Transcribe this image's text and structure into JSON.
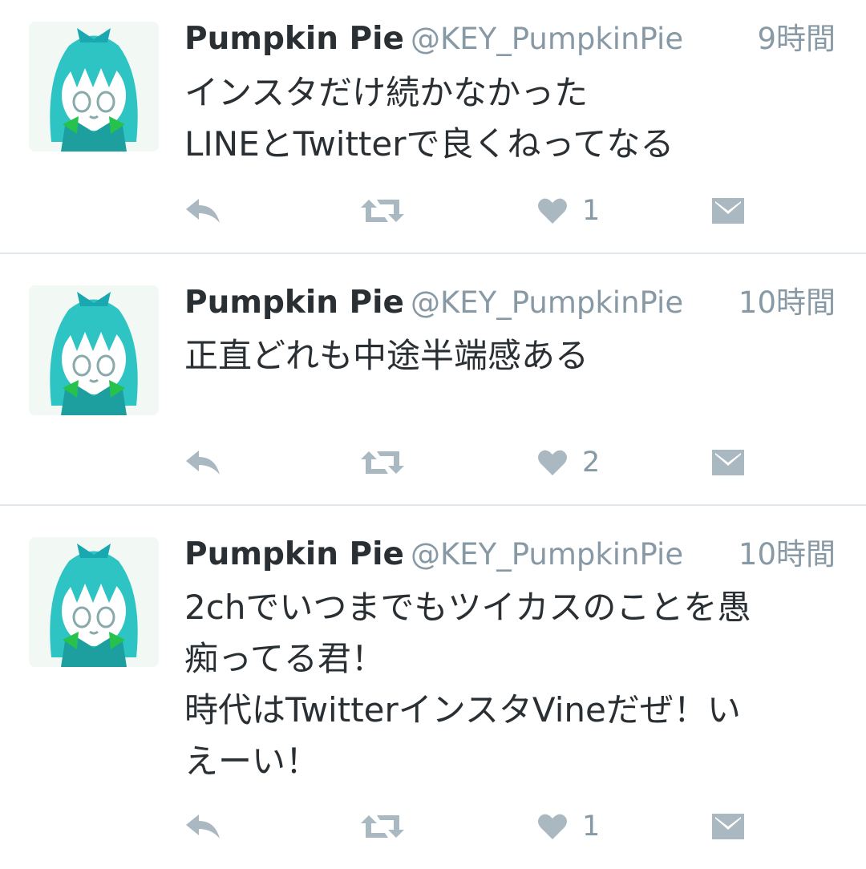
{
  "colors": {
    "name": "#292f33",
    "secondary": "#8899a6",
    "icon": "#aab8c2",
    "divider": "#e1e8ed"
  },
  "tweets": [
    {
      "name": "Pumpkin Pie",
      "handle": "@KEY_PumpkinPie",
      "time": "9時間",
      "text": "インスタだけ続かなかった\nLINEとTwitterで良くねってなる",
      "likes": "1"
    },
    {
      "name": "Pumpkin Pie",
      "handle": "@KEY_PumpkinPie",
      "time": "10時間",
      "text": "正直どれも中途半端感ある",
      "likes": "2"
    },
    {
      "name": "Pumpkin Pie",
      "handle": "@KEY_PumpkinPie",
      "time": "10時間",
      "text": "2chでいつまでもツイカスのことを愚\n痴ってる君！\n時代はTwitterインスタVineだぜ！い\nえーい！",
      "likes": "1"
    }
  ],
  "icons": {
    "reply": "reply-icon",
    "retweet": "retweet-icon",
    "like": "heart-icon",
    "dm": "envelope-icon"
  }
}
